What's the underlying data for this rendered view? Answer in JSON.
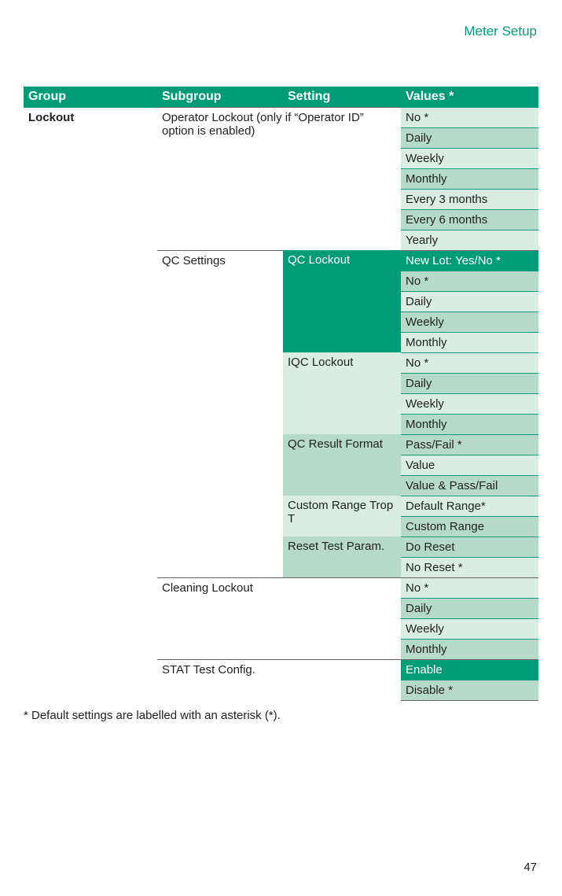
{
  "header": "Meter Setup",
  "columns": {
    "group": "Group",
    "subgroup": "Subgroup",
    "setting": "Setting",
    "values": "Values *"
  },
  "group": "Lockout",
  "subgroups": {
    "operator_lockout": {
      "label": "Operator Lockout (only if “Operator ID” option is enabled)",
      "values": [
        "No *",
        "Daily",
        "Weekly",
        "Monthly",
        "Every 3 months",
        "Every 6 months",
        "Yearly"
      ]
    },
    "qc_settings": {
      "label": "QC Settings",
      "settings": {
        "qc_lockout": {
          "label": " QC Lockout",
          "values": [
            "New Lot: Yes/No *",
            "No *",
            "Daily",
            "Weekly",
            "Monthly"
          ]
        },
        "iqc_lockout": {
          "label": "IQC Lockout",
          "values": [
            "No *",
            "Daily",
            "Weekly",
            "Monthly"
          ]
        },
        "qc_result_format": {
          "label": "QC Result Format",
          "values": [
            "Pass/Fail *",
            "Value",
            "Value & Pass/Fail"
          ]
        },
        "custom_range_trop_t": {
          "label": "Custom Range Trop T",
          "values": [
            "Default Range*",
            "Custom Range"
          ]
        },
        "reset_test_param": {
          "label": "Reset Test Param.",
          "values": [
            "Do Reset",
            "No Reset *"
          ]
        }
      }
    },
    "cleaning_lockout": {
      "label": "Cleaning Lockout",
      "values": [
        "No *",
        "Daily",
        "Weekly",
        "Monthly"
      ]
    },
    "stat_test_config": {
      "label": "STAT Test Config.",
      "values": [
        "Enable",
        "Disable *"
      ]
    }
  },
  "footnote": "* Default settings are labelled with an asterisk (*).",
  "page_number": "47"
}
